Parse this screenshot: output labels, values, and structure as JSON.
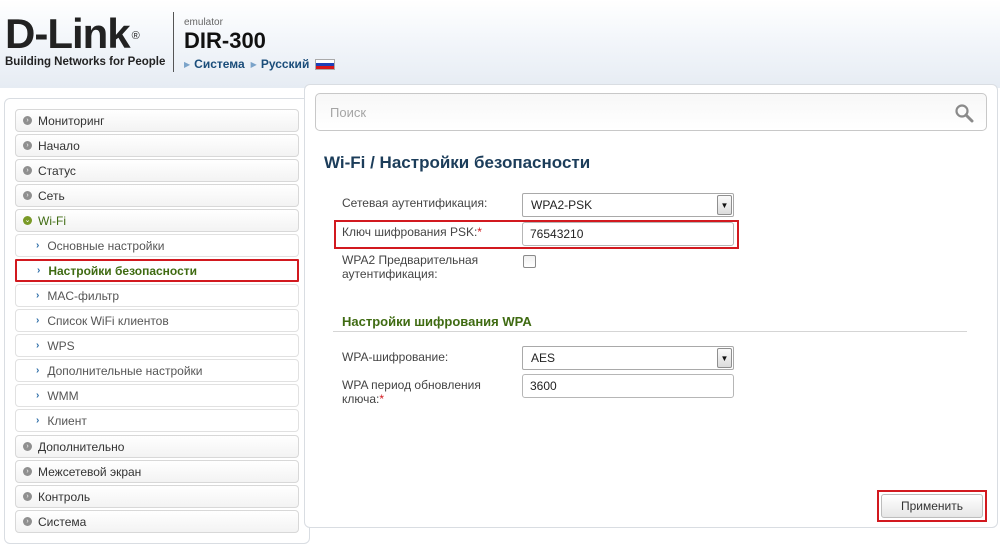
{
  "header": {
    "logo_text": "D-Link",
    "logo_reg": "®",
    "logo_tagline": "Building Networks for People",
    "emulator_label": "emulator",
    "model": "DIR-300",
    "crumbs": [
      "Система",
      "Русский"
    ]
  },
  "sidebar": {
    "items": [
      {
        "label": "Мониторинг"
      },
      {
        "label": "Начало"
      },
      {
        "label": "Статус"
      },
      {
        "label": "Сеть"
      },
      {
        "label": "Wi-Fi"
      },
      {
        "label": "Основные настройки"
      },
      {
        "label": "Настройки безопасности"
      },
      {
        "label": "MAC-фильтр"
      },
      {
        "label": "Список WiFi клиентов"
      },
      {
        "label": "WPS"
      },
      {
        "label": "Дополнительные настройки"
      },
      {
        "label": "WMM"
      },
      {
        "label": "Клиент"
      },
      {
        "label": "Дополнительно"
      },
      {
        "label": "Межсетевой экран"
      },
      {
        "label": "Контроль"
      },
      {
        "label": "Система"
      }
    ]
  },
  "search": {
    "placeholder": "Поиск"
  },
  "page": {
    "title": "Wi-Fi /  Настройки безопасности",
    "auth_label": "Сетевая аутентификация:",
    "auth_value": "WPA2-PSK",
    "psk_label": "Ключ шифрования PSK:",
    "psk_value": "76543210",
    "preauth_label_1": "WPA2 Предварительная",
    "preauth_label_2": "аутентификация:",
    "section_title": "Настройки шифрования WPA",
    "wpa_enc_label": "WPA-шифрование:",
    "wpa_enc_value": "AES",
    "renew_label_1": "WPA период обновления",
    "renew_label_2": "ключа:",
    "renew_value": "3600",
    "required_mark": "*",
    "apply_label": "Применить"
  },
  "colors": {
    "accent_green": "#3f6b12",
    "highlight_red": "#d2191f",
    "title_blue": "#1c3d5a"
  },
  "icons": [
    "dlink-logo",
    "russian-flag-icon",
    "search-icon",
    "expand-icon",
    "collapse-icon",
    "chevron-right-icon",
    "dropdown-arrow-icon"
  ]
}
